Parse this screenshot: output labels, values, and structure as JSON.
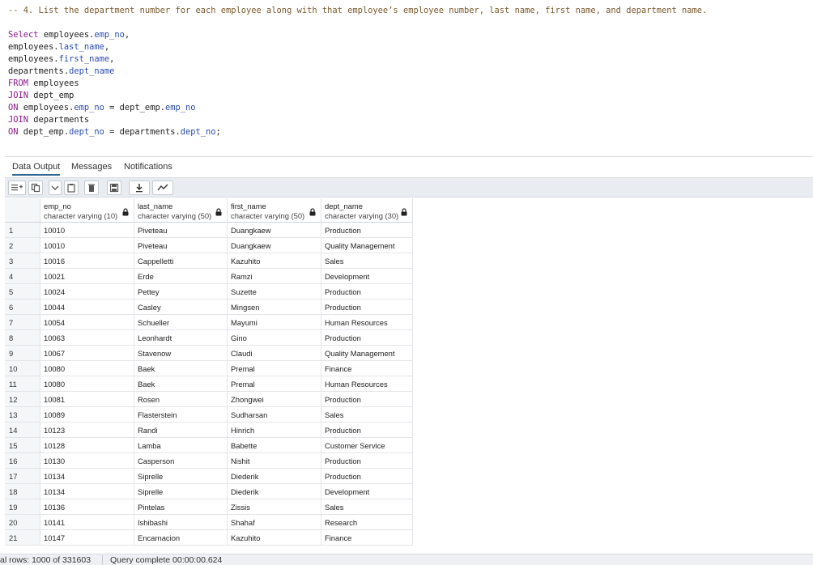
{
  "editor": {
    "lines": [
      [
        {
          "t": "-- 4. List the department number for each employee along with that employee’s employee number, last name, first name, and department name.",
          "c": "comment"
        }
      ],
      [],
      [
        {
          "t": "Select",
          "c": "kw"
        },
        {
          "t": " employees.",
          "c": "plain"
        },
        {
          "t": "emp_no",
          "c": "col"
        },
        {
          "t": ",",
          "c": "plain"
        }
      ],
      [
        {
          "t": "employees.",
          "c": "plain"
        },
        {
          "t": "last_name",
          "c": "col"
        },
        {
          "t": ",",
          "c": "plain"
        }
      ],
      [
        {
          "t": "employees.",
          "c": "plain"
        },
        {
          "t": "first_name",
          "c": "col"
        },
        {
          "t": ",",
          "c": "plain"
        }
      ],
      [
        {
          "t": "departments.",
          "c": "plain"
        },
        {
          "t": "dept_name",
          "c": "col"
        }
      ],
      [
        {
          "t": "FROM",
          "c": "kw"
        },
        {
          "t": " employees",
          "c": "plain"
        }
      ],
      [
        {
          "t": "JOIN",
          "c": "kw"
        },
        {
          "t": " dept_emp",
          "c": "plain"
        }
      ],
      [
        {
          "t": "ON",
          "c": "kw"
        },
        {
          "t": " employees.",
          "c": "plain"
        },
        {
          "t": "emp_no",
          "c": "col"
        },
        {
          "t": " = dept_emp.",
          "c": "plain"
        },
        {
          "t": "emp_no",
          "c": "col"
        }
      ],
      [
        {
          "t": "JOIN",
          "c": "kw"
        },
        {
          "t": " departments",
          "c": "plain"
        }
      ],
      [
        {
          "t": "ON",
          "c": "kw"
        },
        {
          "t": " dept_emp.",
          "c": "plain"
        },
        {
          "t": "dept_no",
          "c": "col"
        },
        {
          "t": " = departments.",
          "c": "plain"
        },
        {
          "t": "dept_no",
          "c": "col"
        },
        {
          "t": ";",
          "c": "plain"
        }
      ]
    ]
  },
  "tabs": {
    "data_output": "Data Output",
    "messages": "Messages",
    "notifications": "Notifications"
  },
  "toolbar": {
    "icons": [
      "add-row-icon",
      "copy-icon",
      "dropdown-icon",
      "paste-icon",
      "delete-icon",
      "save-data-icon",
      "download-icon",
      "graph-icon"
    ]
  },
  "grid": {
    "columns": [
      {
        "name": "emp_no",
        "type": "character varying (10)"
      },
      {
        "name": "last_name",
        "type": "character varying (50)"
      },
      {
        "name": "first_name",
        "type": "character varying (50)"
      },
      {
        "name": "dept_name",
        "type": "character varying (30)"
      }
    ],
    "rows": [
      [
        "1",
        "10010",
        "Piveteau",
        "Duangkaew",
        "Production"
      ],
      [
        "2",
        "10010",
        "Piveteau",
        "Duangkaew",
        "Quality Management"
      ],
      [
        "3",
        "10016",
        "Cappelletti",
        "Kazuhito",
        "Sales"
      ],
      [
        "4",
        "10021",
        "Erde",
        "Ramzi",
        "Development"
      ],
      [
        "5",
        "10024",
        "Pettey",
        "Suzette",
        "Production"
      ],
      [
        "6",
        "10044",
        "Casley",
        "Mingsen",
        "Production"
      ],
      [
        "7",
        "10054",
        "Schueller",
        "Mayumi",
        "Human Resources"
      ],
      [
        "8",
        "10063",
        "Leonhardt",
        "Gino",
        "Production"
      ],
      [
        "9",
        "10067",
        "Stavenow",
        "Claudi",
        "Quality Management"
      ],
      [
        "10",
        "10080",
        "Baek",
        "Premal",
        "Finance"
      ],
      [
        "11",
        "10080",
        "Baek",
        "Premal",
        "Human Resources"
      ],
      [
        "12",
        "10081",
        "Rosen",
        "Zhongwei",
        "Production"
      ],
      [
        "13",
        "10089",
        "Flasterstein",
        "Sudharsan",
        "Sales"
      ],
      [
        "14",
        "10123",
        "Randi",
        "Hinrich",
        "Production"
      ],
      [
        "15",
        "10128",
        "Lamba",
        "Babette",
        "Customer Service"
      ],
      [
        "16",
        "10130",
        "Casperson",
        "Nishit",
        "Production"
      ],
      [
        "17",
        "10134",
        "Siprelle",
        "Diederik",
        "Production"
      ],
      [
        "18",
        "10134",
        "Siprelle",
        "Diederik",
        "Development"
      ],
      [
        "19",
        "10136",
        "Pintelas",
        "Zissis",
        "Sales"
      ],
      [
        "20",
        "10141",
        "Ishibashi",
        "Shahaf",
        "Research"
      ],
      [
        "21",
        "10147",
        "Encarnacion",
        "Kazuhito",
        "Finance"
      ]
    ]
  },
  "status": {
    "rows": "al rows: 1000 of 331603",
    "query": "Query complete 00:00:00.624"
  },
  "colors": {
    "keyword": "#8a1a8a",
    "column": "#2a4db0",
    "comment": "#7a5a2e",
    "tab_active": "#326690"
  }
}
